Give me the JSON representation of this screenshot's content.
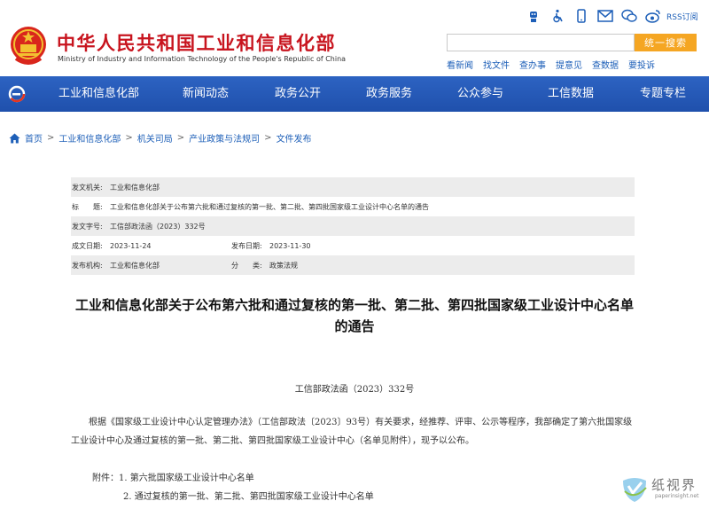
{
  "header": {
    "title_cn": "中华人民共和国工业和信息化部",
    "title_en": "Ministry of Industry and Information Technology of the People's Republic of China",
    "top_icons": [
      "accessibility-robot-icon",
      "wheelchair-icon",
      "mobile-icon",
      "mail-icon",
      "wechat-icon",
      "weibo-icon"
    ],
    "rss_label": "RSS订阅",
    "search": {
      "placeholder": "",
      "button_label": "统一搜索"
    },
    "quick_links": [
      "看新闻",
      "找文件",
      "查办事",
      "提意见",
      "查数据",
      "要投诉"
    ]
  },
  "nav": {
    "items": [
      "工业和信息化部",
      "新闻动态",
      "政务公开",
      "政务服务",
      "公众参与",
      "工信数据",
      "专题专栏"
    ]
  },
  "breadcrumb": [
    "首页",
    "工业和信息化部",
    "机关司局",
    "产业政策与法规司",
    "文件发布"
  ],
  "meta": {
    "issuer_label": "发文机关:",
    "issuer": "工业和信息化部",
    "title_label": "标　　题:",
    "title": "工业和信息化部关于公布第六批和通过复核的第一批、第二批、第四批国家级工业设计中心名单的通告",
    "docno_label": "发文字号:",
    "docno": "工信部政法函（2023）332号",
    "created_label": "成文日期:",
    "created": "2023-11-24",
    "published_label": "发布日期:",
    "published": "2023-11-30",
    "publisher_label": "发布机构:",
    "publisher": "工业和信息化部",
    "category_label": "分　　类:",
    "category": "政策法规"
  },
  "article": {
    "title": "工业和信息化部关于公布第六批和通过复核的第一批、第二批、第四批国家级工业设计中心名单的通告",
    "doc_number": "工信部政法函（2023）332号",
    "paragraph": "根据《国家级工业设计中心认定管理办法》（工信部政法〔2023〕93号）有关要求，经推荐、评审、公示等程序，我部确定了第六批国家级工业设计中心及通过复核的第一批、第二批、第四批国家级工业设计中心（名单见附件），现予以公布。",
    "attachment_1": "附件：1. 第六批国家级工业设计中心名单",
    "attachment_2": "2. 通过复核的第一批、第二批、第四批国家级工业设计中心名单"
  },
  "watermark": {
    "cn": "纸视界",
    "en": "paperinsight.net"
  },
  "colors": {
    "nav_blue": "#2559b8",
    "title_red": "#c8141e",
    "search_orange": "#f5a623",
    "link_blue": "#1d5fb8"
  }
}
